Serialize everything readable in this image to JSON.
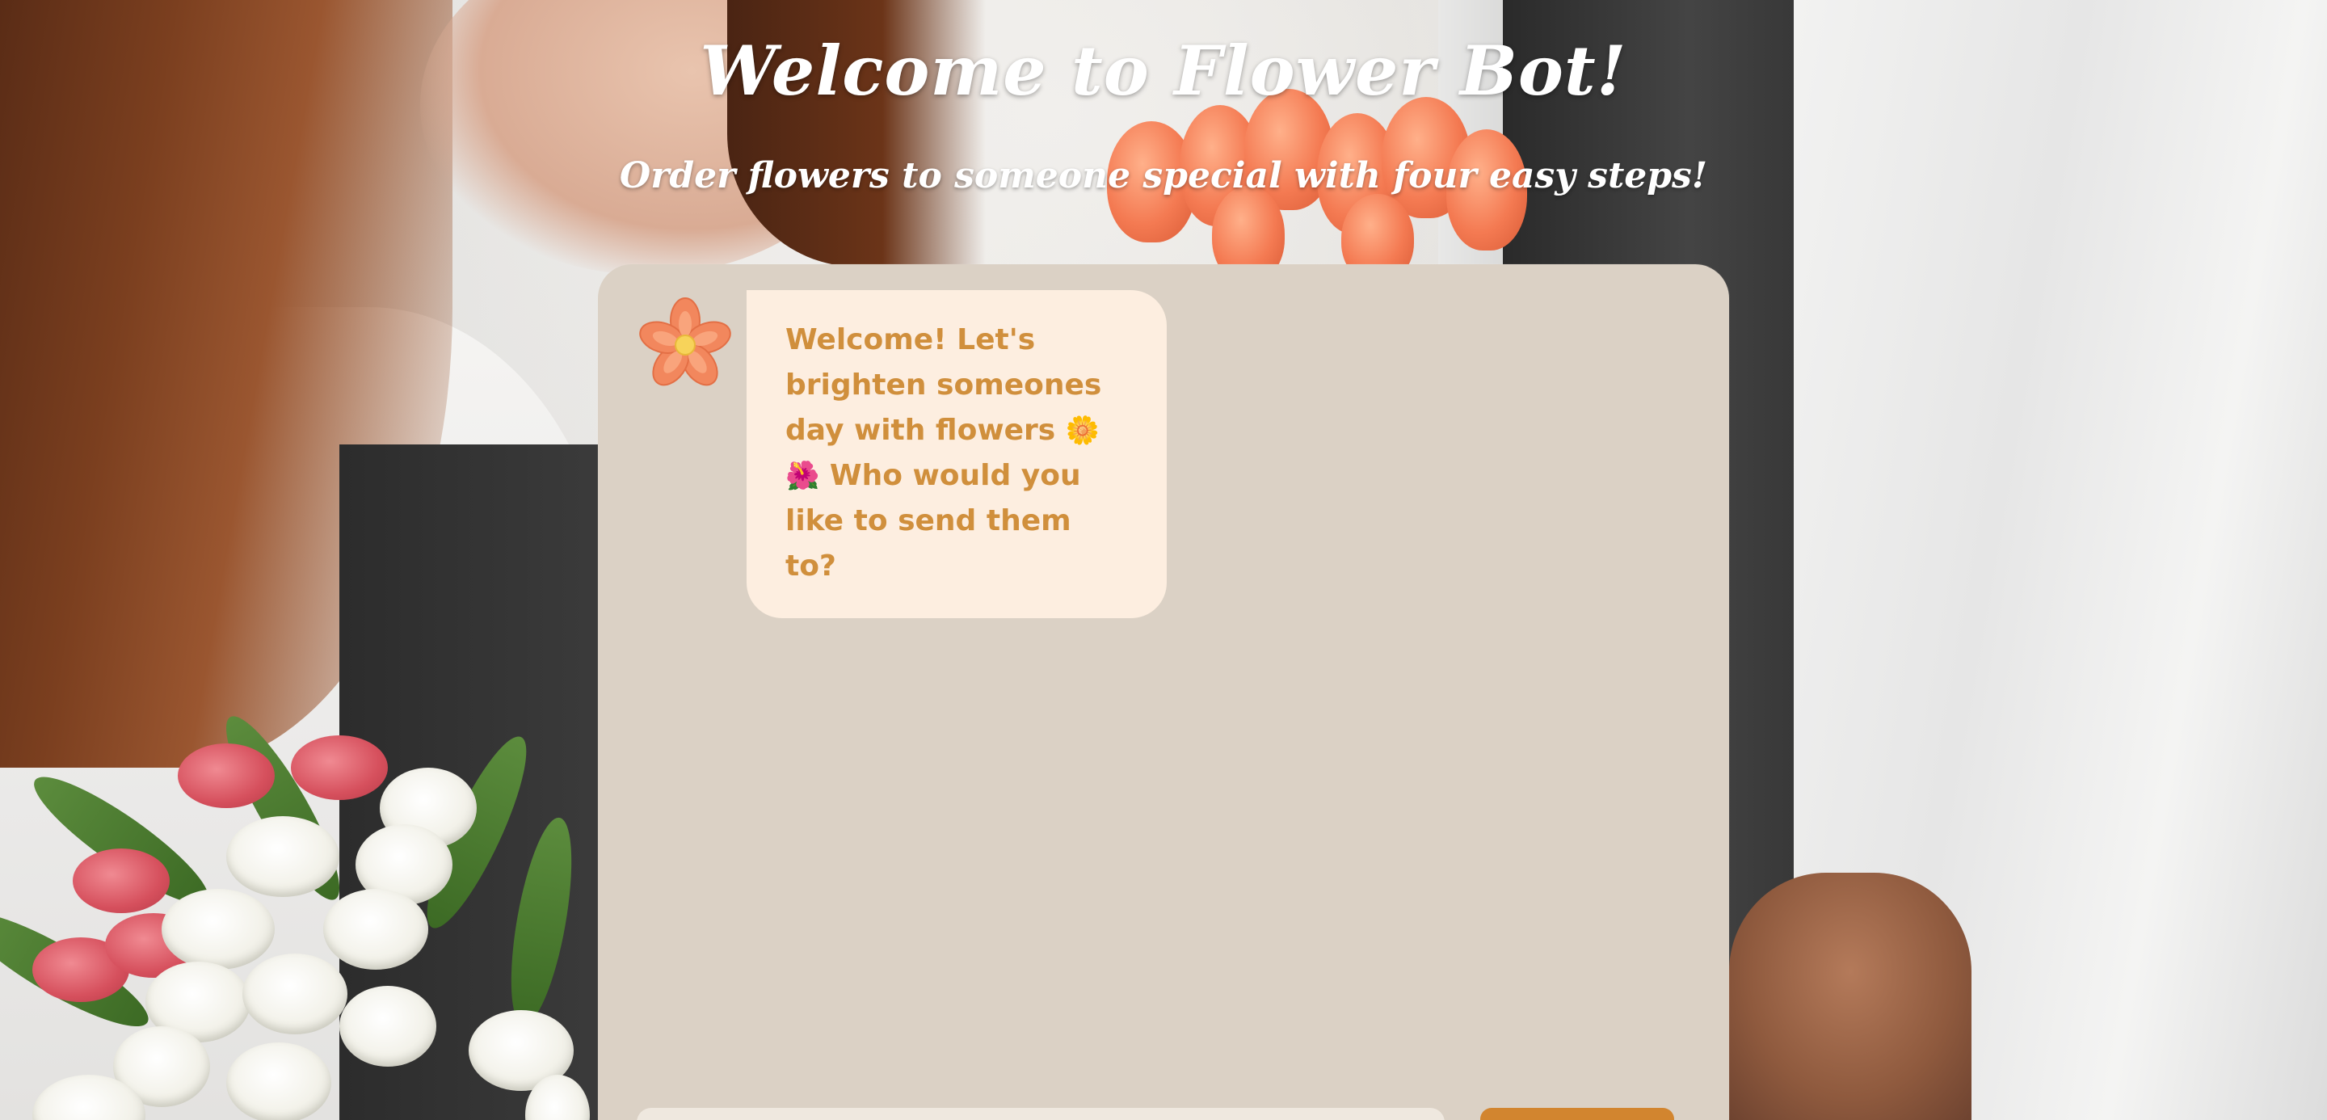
{
  "header": {
    "title": "Welcome to Flower Bot!",
    "subtitle": "Order flowers to someone special with four easy steps!"
  },
  "chat": {
    "messages": [
      {
        "sender": "bot",
        "avatar_icon": "flower-icon",
        "text_part1": "Welcome! Let's brighten someones day with flowers",
        "emoji1": "🌼",
        "emoji2": "🌺",
        "text_part2": "Who would you like to send them to?"
      }
    ]
  },
  "input": {
    "value": "",
    "placeholder": "",
    "send_label": ""
  },
  "colors": {
    "panel": "#dbd1c5",
    "bubble": "#fdeee0",
    "bubble_text": "#d08f3c",
    "send_button": "#d2852f"
  }
}
